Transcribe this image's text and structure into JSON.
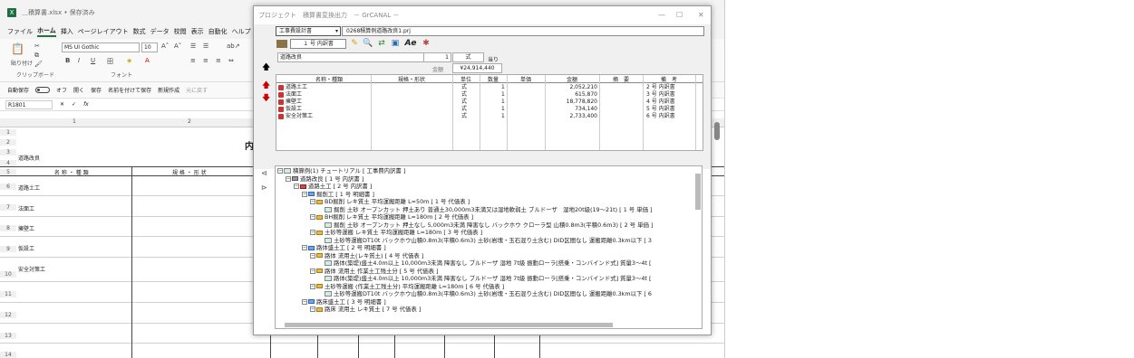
{
  "excel": {
    "title": "＿積算書.xlsx • 保存済み",
    "menus": [
      "ファイル",
      "ホーム",
      "挿入",
      "ページレイアウト",
      "数式",
      "データ",
      "校閲",
      "表示",
      "自動化",
      "ヘルプ"
    ],
    "font_name": "MS UI Gothic",
    "font_size": "10",
    "group_clipboard": "クリップボード",
    "group_font": "フォント",
    "paste_label": "貼り付け",
    "quick": [
      "自動保存",
      "オフ",
      "開く",
      "保存",
      "名前を付けて保存",
      "新規作成",
      "元に戻す"
    ],
    "namebox": "R1801",
    "fx": "fx",
    "col_headers": [
      "1",
      "2"
    ],
    "heading_char": "内",
    "cell_dourokairyo": "道路改良",
    "col_name": "名 称 ・ 種 類",
    "col_spec": "規 格 ・ 形 状",
    "row_labels": [
      "道路土工",
      "法面工",
      "擁壁工",
      "仮設工",
      "安全対策工"
    ],
    "row_numbers": [
      "1",
      "2",
      "3",
      "4",
      "5",
      "6",
      "7",
      "8",
      "9",
      "10",
      "11",
      "12",
      "13",
      "14"
    ]
  },
  "win": {
    "title": "プロジェクト　積算書変換出力　－ GrCANAL －",
    "controls": [
      "—",
      "☐",
      "✕"
    ],
    "doc_combo": "工事費設計書",
    "file_path": "0268積算例道路改良1.prj",
    "sheet_combo": "１ 号 内訳書",
    "name_field": "道路改良",
    "qty_field": "1",
    "unit_field": "式",
    "per_label": "当り",
    "total_label": "金額",
    "total_field": "¥24,914,440",
    "headers": [
      "名称・種類",
      "規格・形状",
      "単位",
      "数量",
      "単価",
      "金額",
      "摘　要",
      "備　考"
    ],
    "rows": [
      {
        "name": "道路土工",
        "unit": "式",
        "qty": "1",
        "amount": "2,052,210",
        "note": "2 号 内訳書"
      },
      {
        "name": "法面工",
        "unit": "式",
        "qty": "1",
        "amount": "615,870",
        "note": "3 号 内訳書"
      },
      {
        "name": "擁壁工",
        "unit": "式",
        "qty": "1",
        "amount": "18,778,820",
        "note": "4 号 内訳書"
      },
      {
        "name": "仮設工",
        "unit": "式",
        "qty": "1",
        "amount": "734,140",
        "note": "5 号 内訳書"
      },
      {
        "name": "安全対策工",
        "unit": "式",
        "qty": "1",
        "amount": "2,733,400",
        "note": "6 号 内訳書"
      }
    ],
    "tree": [
      {
        "level": 0,
        "icon": "doc",
        "text": "積算例(1) チュートリアル [ 工事費内訳書 ]"
      },
      {
        "level": 1,
        "icon": "gray",
        "text": "道路改良 [ 1 号 内訳書 ]"
      },
      {
        "level": 2,
        "icon": "red",
        "text": "道路土工 [ 2 号 内訳書 ]"
      },
      {
        "level": 3,
        "icon": "blue",
        "text": "掘削工 [ 1 号 明細書 ]"
      },
      {
        "level": 4,
        "icon": "folder",
        "text": "BD掘削 レキ質土 平均運搬距離 L=50m [ 1 号 代価表 ]"
      },
      {
        "level": 5,
        "icon": "doc",
        "text": "掘削 土砂 オープンカット 押土あり 普通土30,000m3未満又は湿地軟弱土 ブルドーザ　湿地20t級(19～21t) [ 1 号 単価 ]"
      },
      {
        "level": 4,
        "icon": "folder",
        "text": "BH掘削 レキ質土 平均運搬距離 L=180m [ 2 号 代価表 ]"
      },
      {
        "level": 5,
        "icon": "doc",
        "text": "掘削 土砂 オープンカット 押土なし 5,000m3未満 障害なし バックホウ クローラ型 山積0.8m3(平積0.6m3) [ 2 号 単価 ]"
      },
      {
        "level": 4,
        "icon": "folder",
        "text": "土砂等運搬 レキ質土 平均運搬距離 L=180m [ 3 号 代価表 ]"
      },
      {
        "level": 5,
        "icon": "doc",
        "text": "土砂等運搬DT10t バックホウ山積0.8m3(平積0.6m3) 土砂(岩塊・玉石混り土含む) DID区間なし 運搬距離0.3km以下 [ 3"
      },
      {
        "level": 3,
        "icon": "blue",
        "text": "路体盛土工 [ 2 号 明細書 ]"
      },
      {
        "level": 4,
        "icon": "folder",
        "text": "路体 流用土(レキ質土) [ 4 号 代価表 ]"
      },
      {
        "level": 5,
        "icon": "doc",
        "text": "路体(築堤)盛土4.0m以上 10,000m3未満 障害なし ブルドーザ 湿地 7t級 振動ローラ[搭乗・コンバインド式] 質量3～4t ["
      },
      {
        "level": 4,
        "icon": "folder",
        "text": "路体 流用土 作業土工残土分 [ 5 号 代価表 ]"
      },
      {
        "level": 5,
        "icon": "doc",
        "text": "路体(築堤)盛土4.0m以上 10,000m3未満 障害なし ブルドーザ 湿地 7t級 振動ローラ[搭乗・コンバインド式] 質量3～4t ["
      },
      {
        "level": 4,
        "icon": "folder",
        "text": "土砂等運搬 (作業土工残土分) 平均運搬距離 L=180m [ 6 号 代価表 ]"
      },
      {
        "level": 5,
        "icon": "doc",
        "text": "土砂等運搬DT10t バックホウ山積0.8m3(平積0.6m3) 土砂(岩塊・玉石混り土含む) DID区間なし 運搬距離0.3km以下 [ 6"
      },
      {
        "level": 3,
        "icon": "blue",
        "text": "路床盛土工 [ 3 号 明細書 ]"
      },
      {
        "level": 4,
        "icon": "folder",
        "text": "路床 流用土 レキ質土 [ 7 号 代価表 ]"
      }
    ]
  }
}
